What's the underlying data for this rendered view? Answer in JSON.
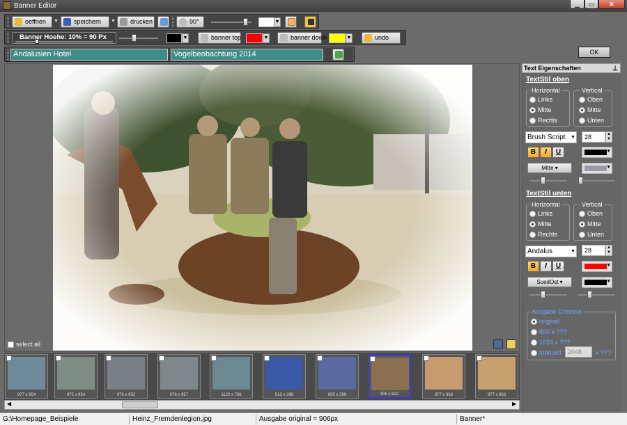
{
  "window": {
    "title": "Banner  Editor"
  },
  "toolbar1": {
    "open": "oeffnen",
    "save": "speichern",
    "print": "drucken",
    "rotate": "90°"
  },
  "toolbar2": {
    "banner_height": "Banner Hoehe: 10% = 90 Px",
    "banner_top": "banner top",
    "banner_down": "banner down",
    "undo": "undo"
  },
  "toolbar3": {
    "text_top": "Andalusien Hotel",
    "text_bottom": "Vogelbeobachtung 2014"
  },
  "ok_label": "OK",
  "select_all": "select all",
  "panel": {
    "header": "Text Eigenschaften",
    "top": {
      "title": "TextStil oben",
      "horizontal": "Horizontal",
      "h_options": [
        "Links",
        "Mitte",
        "Rechts"
      ],
      "h_selected": "Mitte",
      "vertical": "Vertical",
      "v_options": [
        "Oben",
        "Mitte",
        "Unten"
      ],
      "v_selected": "Mitte",
      "font": "Brush Script",
      "size": "28",
      "shadow_dir": "Mitte"
    },
    "bottom": {
      "title": "TextStil unten",
      "horizontal": "Horizontal",
      "h_options": [
        "Links",
        "Mitte",
        "Rechts"
      ],
      "h_selected": "Mitte",
      "vertical": "Vertical",
      "v_options": [
        "Oben",
        "Mitte",
        "Unten"
      ],
      "v_selected": "Mitte",
      "font": "Andalus",
      "size": "28",
      "shadow_dir": "SuedOst"
    },
    "output": {
      "title": "Ausgabe Groesse",
      "options": [
        "original",
        "800 x ???",
        "1024 x ???",
        "manuell"
      ],
      "manual_value": "2048",
      "manual_suffix": "x ???"
    }
  },
  "thumbnails": [
    "977 x 954",
    "975 x 954",
    "976 x 952",
    "976 x 957",
    "1120 x 766",
    "513 x 398",
    "895 x 399",
    "906 x 622",
    "977 x 962",
    "977 x 963"
  ],
  "status": {
    "path": "G:\\Homepage_Beispiele",
    "file": "Heinz_Fremdenlegion.jpg",
    "output": "Ausgabe original = 906px",
    "app": "Banner*"
  },
  "colors": {
    "text_top_color": "#000000",
    "text_bottom_color": "#ff0000",
    "banner_color": "#000000",
    "banner_top_color": "#ff0000",
    "banner_down_color": "#ffff00",
    "teal": "#3e8c88"
  }
}
